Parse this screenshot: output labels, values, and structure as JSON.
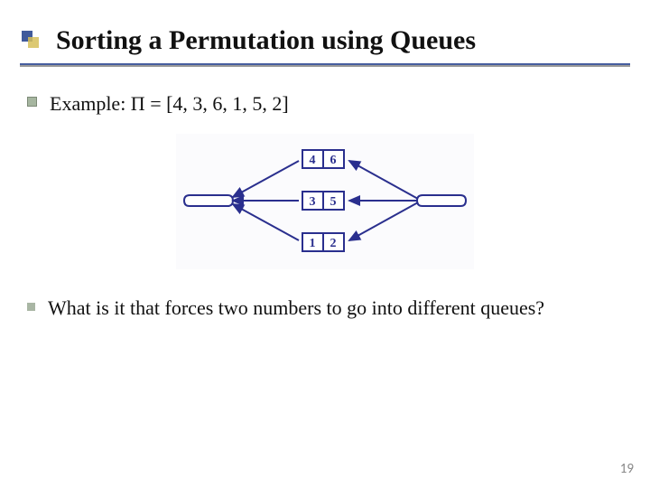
{
  "title": "Sorting a Permutation using Queues",
  "bullets": [
    {
      "text": "Example: Π = [4, 3, 6, 1, 5, 2]"
    },
    {
      "text": "What is it that forces two numbers to go into different queues?"
    }
  ],
  "diagram": {
    "queues": [
      {
        "a": "4",
        "b": "6"
      },
      {
        "a": "3",
        "b": "5"
      },
      {
        "a": "1",
        "b": "2"
      }
    ]
  },
  "pageNumber": "19"
}
